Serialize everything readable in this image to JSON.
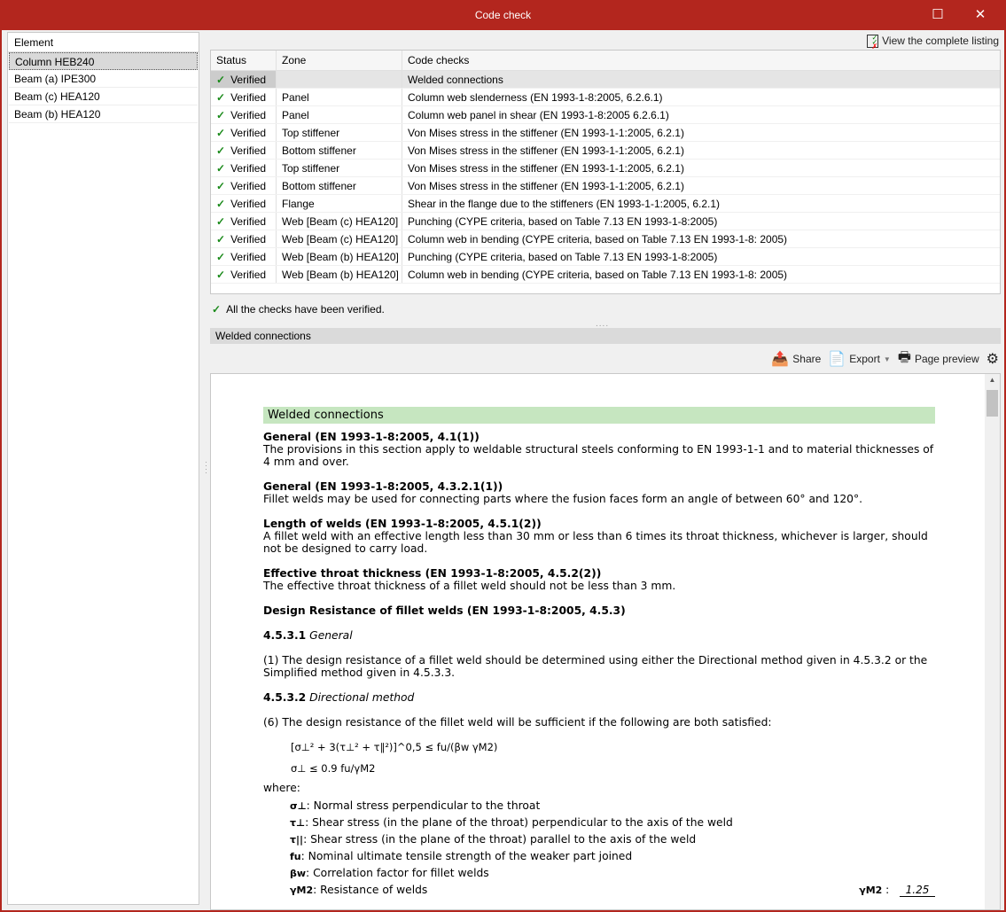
{
  "window": {
    "title": "Code check",
    "maximize": "☐",
    "close": "✕"
  },
  "elements": {
    "header": "Element",
    "items": [
      "Column HEB240",
      "Beam (a) IPE300",
      "Beam (c) HEA120",
      "Beam (b) HEA120"
    ]
  },
  "listing_button": "View the complete listing",
  "table": {
    "headers": [
      "Status",
      "Zone",
      "Code checks"
    ],
    "rows": [
      {
        "status": "Verified",
        "zone": "",
        "check": "Welded connections"
      },
      {
        "status": "Verified",
        "zone": "Panel",
        "check": "Column web slenderness (EN 1993-1-8:2005, 6.2.6.1)"
      },
      {
        "status": "Verified",
        "zone": "Panel",
        "check": "Column web panel in shear (EN 1993-1-8:2005 6.2.6.1)"
      },
      {
        "status": "Verified",
        "zone": "Top stiffener",
        "check": "Von Mises stress in the stiffener (EN 1993-1-1:2005, 6.2.1)"
      },
      {
        "status": "Verified",
        "zone": "Bottom stiffener",
        "check": "Von Mises stress in the stiffener (EN 1993-1-1:2005, 6.2.1)"
      },
      {
        "status": "Verified",
        "zone": "Top stiffener",
        "check": "Von Mises stress in the stiffener (EN 1993-1-1:2005, 6.2.1)"
      },
      {
        "status": "Verified",
        "zone": "Bottom stiffener",
        "check": "Von Mises stress in the stiffener (EN 1993-1-1:2005, 6.2.1)"
      },
      {
        "status": "Verified",
        "zone": "Flange",
        "check": "Shear in the flange due to the stiffeners (EN 1993-1-1:2005, 6.2.1)"
      },
      {
        "status": "Verified",
        "zone": "Web [Beam (c) HEA120]",
        "check": "Punching (CYPE criteria, based on Table 7.13 EN 1993-1-8:2005)"
      },
      {
        "status": "Verified",
        "zone": "Web [Beam (c) HEA120]",
        "check": "Column web in bending (CYPE criteria, based on Table 7.13 EN 1993-1-8: 2005)"
      },
      {
        "status": "Verified",
        "zone": "Web [Beam (b) HEA120]",
        "check": "Punching (CYPE criteria, based on Table 7.13 EN 1993-1-8:2005)"
      },
      {
        "status": "Verified",
        "zone": "Web [Beam (b) HEA120]",
        "check": "Column web in bending (CYPE criteria, based on Table 7.13 EN 1993-1-8: 2005)"
      }
    ]
  },
  "status_message": "All the checks have been verified.",
  "section_title": "Welded connections",
  "toolbar": {
    "share": "Share",
    "export": "Export",
    "page_preview": "Page preview"
  },
  "doc": {
    "header": "Welded connections",
    "s1_title": "General (EN 1993-1-8:2005, 4.1(1))",
    "s1_text": "The provisions in this section apply to weldable structural steels conforming to EN 1993-1-1 and to material thicknesses of 4 mm and over.",
    "s2_title": "General (EN 1993-1-8:2005, 4.3.2.1(1))",
    "s2_text": "Fillet welds may be used for connecting parts where the fusion faces form an angle of between 60° and 120°.",
    "s3_title": "Length of welds (EN 1993-1-8:2005, 4.5.1(2))",
    "s3_text": "A fillet weld with an effective length less than 30 mm or less than 6 times its throat thickness, whichever is larger, should not be designed to carry load.",
    "s4_title": "Effective throat thickness (EN 1993-1-8:2005, 4.5.2(2))",
    "s4_text": "The effective throat thickness of a fillet weld should not be less than 3 mm.",
    "s5_title": "Design Resistance of fillet welds (EN 1993-1-8:2005, 4.5.3)",
    "s531_num": "4.5.3.1",
    "s531_name": "General",
    "s531_text": "(1) The design resistance of a fillet weld should be determined using either the Directional method given in 4.5.3.2 or the Simplified method given in 4.5.3.3.",
    "s532_num": "4.5.3.2",
    "s532_name": "Directional method",
    "s532_text": "(6) The design resistance of the fillet weld will be sufficient if the following are both satisfied:",
    "formula1": "[σ⊥² + 3(τ⊥² + τ∥²)]^0,5 ≤ fu/(βw γM2)",
    "formula2": "σ⊥ ≤ 0.9 fu/γM2",
    "where": "where:",
    "defs": [
      {
        "sym": "σ⊥",
        "text": ": Normal stress perpendicular to the throat"
      },
      {
        "sym": "τ⊥",
        "text": ": Shear stress (in the plane of the throat) perpendicular to the axis of the weld"
      },
      {
        "sym": "τ||",
        "text": ": Shear stress (in the plane of the throat) parallel to the axis of the weld"
      },
      {
        "sym": "fu",
        "text": ": Nominal ultimate tensile strength of the weaker part joined"
      },
      {
        "sym": "βw",
        "text": ": Correlation factor for fillet welds"
      },
      {
        "sym": "γM2",
        "text": ": Resistance of welds"
      }
    ],
    "gamma_label": "γM2",
    "gamma_value": "1.25"
  }
}
